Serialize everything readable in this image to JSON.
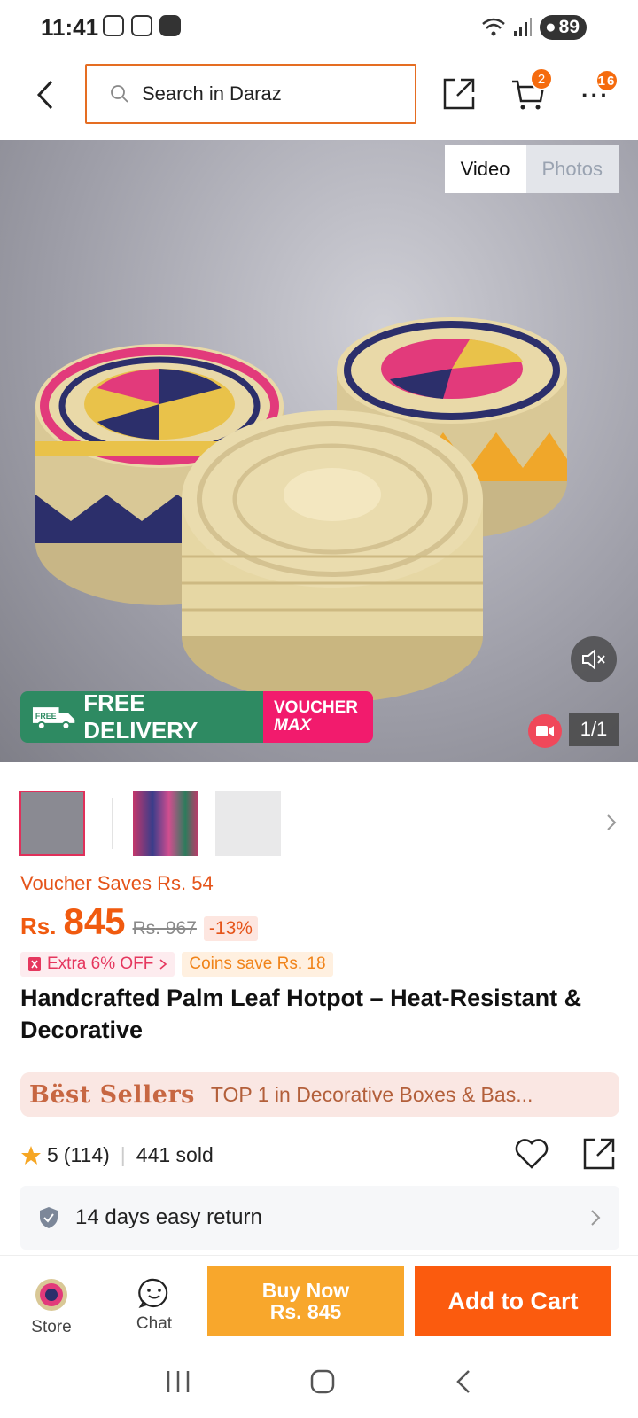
{
  "status_bar": {
    "time": "11:41",
    "battery": "89"
  },
  "nav": {
    "search_placeholder": "Search in Daraz",
    "cart_count": "2",
    "more_count": "16"
  },
  "media": {
    "tabs": [
      {
        "label": "Video",
        "active": true
      },
      {
        "label": "Photos",
        "active": false
      }
    ],
    "free_delivery": "FREE DELIVERY",
    "free_tag": "FREE",
    "voucher_max_line1": "VOUCHER",
    "voucher_max_line2": "MAX",
    "counter": "1/1"
  },
  "product": {
    "voucher_saves": "Voucher Saves Rs. 54",
    "currency": "Rs.",
    "price": "845",
    "old_price": "Rs. 967",
    "discount": "-13%",
    "extra_off": "Extra 6% OFF",
    "coins_save": "Coins save Rs. 18",
    "title": "Handcrafted Palm Leaf Hotpot – Heat-Resistant & Decorative",
    "best_sellers_label": "Bëst Sellers",
    "best_sellers_text": "TOP 1 in Decorative Boxes & Bas...",
    "rating": "5",
    "reviews": "(114)",
    "sold": "441 sold",
    "returns": "14 days easy return"
  },
  "bottom_bar": {
    "store_label": "Store",
    "chat_label": "Chat",
    "buy_now_label": "Buy Now",
    "buy_now_price": "Rs. 845",
    "add_to_cart_label": "Add to Cart"
  },
  "colors": {
    "accent": "#f05a0f",
    "buy_now": "#f8a72c",
    "add_to_cart": "#fb5b0e",
    "free_delivery": "#2e8a62",
    "voucher_max": "#f21b6d"
  }
}
